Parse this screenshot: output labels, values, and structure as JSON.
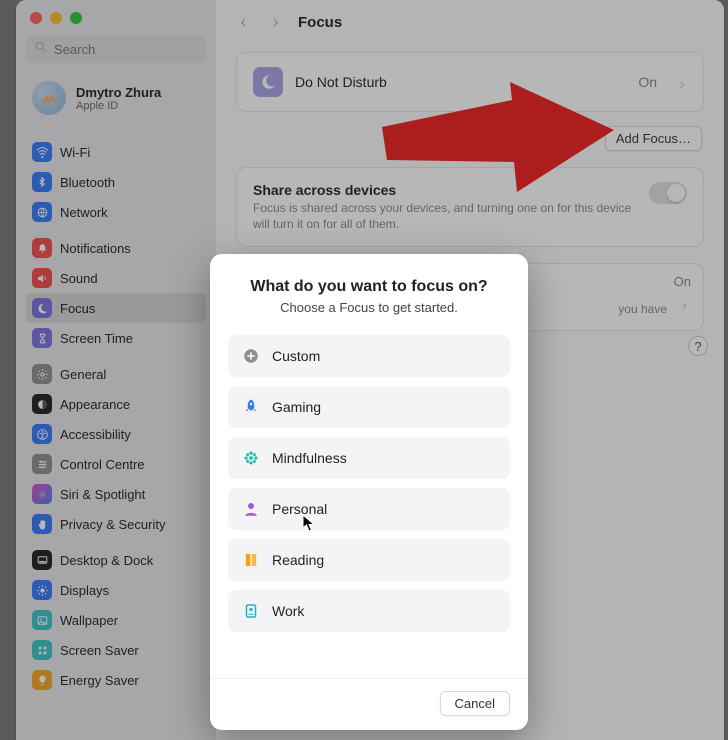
{
  "window": {
    "title": "Focus",
    "search_placeholder": "Search"
  },
  "account": {
    "name": "Dmytro Zhura",
    "subtitle": "Apple ID"
  },
  "sidebar": {
    "groups": [
      [
        {
          "label": "Wi-Fi",
          "color": "#3478f6",
          "icon": "wifi"
        },
        {
          "label": "Bluetooth",
          "color": "#3478f6",
          "icon": "bluetooth"
        },
        {
          "label": "Network",
          "color": "#3478f6",
          "icon": "globe"
        }
      ],
      [
        {
          "label": "Notifications",
          "color": "#f24b4b",
          "icon": "bell"
        },
        {
          "label": "Sound",
          "color": "#f24b4b",
          "icon": "speaker"
        },
        {
          "label": "Focus",
          "color": "#7b6fe0",
          "icon": "moon",
          "selected": true
        },
        {
          "label": "Screen Time",
          "color": "#7b6fe0",
          "icon": "hourglass"
        }
      ],
      [
        {
          "label": "General",
          "color": "#8e8e93",
          "icon": "gear"
        },
        {
          "label": "Appearance",
          "color": "#1f1f1f",
          "icon": "appearance"
        },
        {
          "label": "Accessibility",
          "color": "#3478f6",
          "icon": "accessibility"
        },
        {
          "label": "Control Centre",
          "color": "#8e8e93",
          "icon": "sliders"
        },
        {
          "label": "Siri & Spotlight",
          "color": "linear",
          "icon": "siri"
        },
        {
          "label": "Privacy & Security",
          "color": "#3478f6",
          "icon": "hand"
        }
      ],
      [
        {
          "label": "Desktop & Dock",
          "color": "#1f1f1f",
          "icon": "dock"
        },
        {
          "label": "Displays",
          "color": "#3478f6",
          "icon": "sun"
        },
        {
          "label": "Wallpaper",
          "color": "#38c1c6",
          "icon": "wallpaper"
        },
        {
          "label": "Screen Saver",
          "color": "#38c1c6",
          "icon": "grid"
        },
        {
          "label": "Energy Saver",
          "color": "#f5a623",
          "icon": "bulb"
        }
      ]
    ]
  },
  "focus": {
    "do_not_disturb_label": "Do Not Disturb",
    "do_not_disturb_status": "On",
    "add_button": "Add Focus…",
    "share_title": "Share across devices",
    "share_desc": "Focus is shared across your devices, and turning one on for this device will turn it on for all of them.",
    "section2_status": "On",
    "section2_desc_tail": "you have",
    "help_label": "?"
  },
  "dialog": {
    "title": "What do you want to focus on?",
    "subtitle": "Choose a Focus to get started.",
    "options": [
      {
        "label": "Custom",
        "icon": "plus",
        "color": "#8e8e93"
      },
      {
        "label": "Gaming",
        "icon": "rocket",
        "color": "#2e7ff5"
      },
      {
        "label": "Mindfulness",
        "icon": "mindfulness",
        "color": "#1fbfa9"
      },
      {
        "label": "Personal",
        "icon": "person",
        "color": "#a259d9"
      },
      {
        "label": "Reading",
        "icon": "book",
        "color": "#f59f0b"
      },
      {
        "label": "Work",
        "icon": "badge",
        "color": "#1fb2c9"
      }
    ],
    "cancel": "Cancel"
  }
}
